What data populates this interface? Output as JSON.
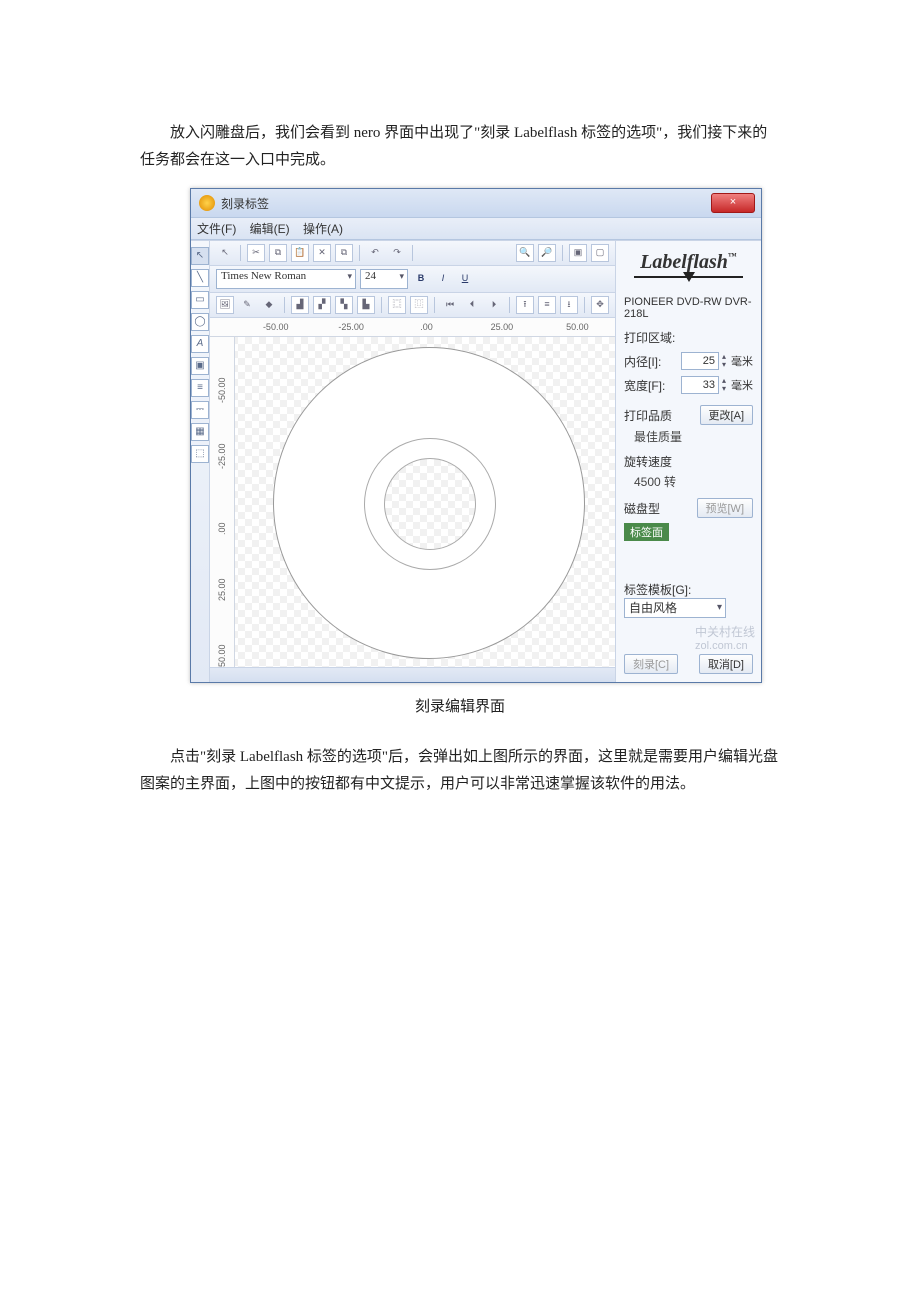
{
  "doc": {
    "para1": "放入闪雕盘后，我们会看到 nero 界面中出现了\"刻录 Labelflash 标签的选项\"，我们接下来的任务都会在这一入口中完成。",
    "caption": "刻录编辑界面",
    "para2": "点击\"刻录 Labelflash 标签的选项\"后，会弹出如上图所示的界面，这里就是需要用户编辑光盘图案的主界面，上图中的按钮都有中文提示，用户可以非常迅速掌握该软件的用法。"
  },
  "win": {
    "title": "刻录标签",
    "close_x": "×",
    "menus": {
      "file": "文件(F)",
      "edit": "编辑(E)",
      "action": "操作(A)"
    },
    "font_name": "Times New Roman",
    "font_size": "24",
    "bold": "B",
    "italic": "I",
    "underline": "U",
    "ruler_h": [
      "-50.00",
      "-25.00",
      ".00",
      "25.00",
      "50.00"
    ],
    "ruler_v": [
      "-50.00",
      "-25.00",
      ".00",
      "25.00",
      "50.00"
    ]
  },
  "right": {
    "logo": "Labelflash",
    "logo_tm": "™",
    "device": "PIONEER DVD-RW  DVR-218L",
    "print_area": "打印区域:",
    "inner_label": "内径[I]:",
    "inner_value": "25",
    "width_label": "宽度[F]:",
    "width_value": "33",
    "unit": "毫米",
    "quality_label": "打印品质",
    "quality_value": "最佳质量",
    "change_btn": "更改[A]",
    "speed_label": "旋转速度",
    "speed_value": "4500 转",
    "disc_type_label": "磁盘型",
    "disc_type_tag": "标签面",
    "preview_btn": "预览[W]",
    "template_label": "标签模板[G]:",
    "template_value": "自由风格",
    "burn_btn": "刻录[C]",
    "cancel_btn": "取消[D]"
  },
  "watermark": {
    "cn": "中关村在线",
    "en": "zol.com.cn"
  }
}
